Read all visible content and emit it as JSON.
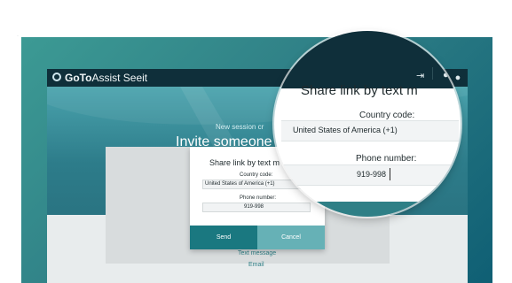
{
  "app": {
    "brand_bold": "GoTo",
    "brand_rest": "Assist Seeit"
  },
  "hero": {
    "new_session": "New session cr",
    "invite": "Invite someone to",
    "cut_letter": "S"
  },
  "dialog": {
    "title": "Share link by text m",
    "country_label": "Country code:",
    "country_value": "United States of America (+1)",
    "phone_label": "Phone number:",
    "phone_value": "919-998",
    "send": "Send",
    "cancel": "Cancel"
  },
  "links": {
    "text_message": "Text message",
    "email": "Email"
  },
  "magnifier": {
    "title": "Share link by text m",
    "country_label": "Country code:",
    "country_value": "United States of America (+1)",
    "phone_label": "Phone number:",
    "phone_value": "919-998"
  },
  "icons": {
    "exit": "sign-in-icon",
    "user": "user-icon"
  },
  "colors": {
    "accent": "#1a7880",
    "cancel": "#66b1b6",
    "topbar": "#0f2f3a"
  }
}
